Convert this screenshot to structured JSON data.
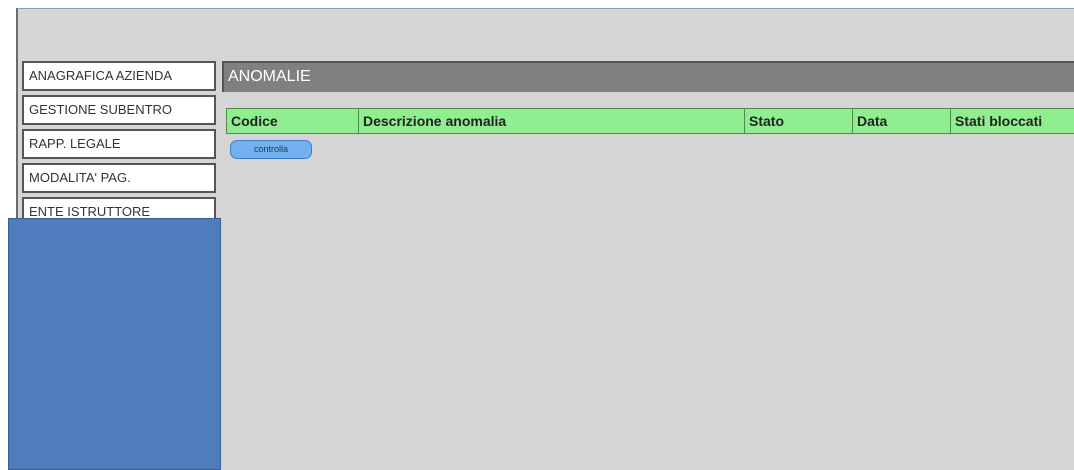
{
  "sidebar": {
    "items": [
      {
        "label": "ANAGRAFICA AZIENDA"
      },
      {
        "label": "GESTIONE SUBENTRO"
      },
      {
        "label": "RAPP. LEGALE"
      },
      {
        "label": "MODALITA' PAG."
      },
      {
        "label": "ENTE ISTRUTTORE"
      }
    ]
  },
  "section": {
    "title": "ANOMALIE"
  },
  "table": {
    "columns": [
      "Codice",
      "Descrizione anomalia",
      "Stato",
      "Data",
      "Stati bloccati"
    ],
    "header_color": "#90ee90"
  },
  "actions": {
    "controlla_label": "controlla"
  },
  "colors": {
    "overlay": "#4f7dbb",
    "header_bar": "#808080",
    "background": "#d6d5d6",
    "button": "#72b1ee"
  }
}
